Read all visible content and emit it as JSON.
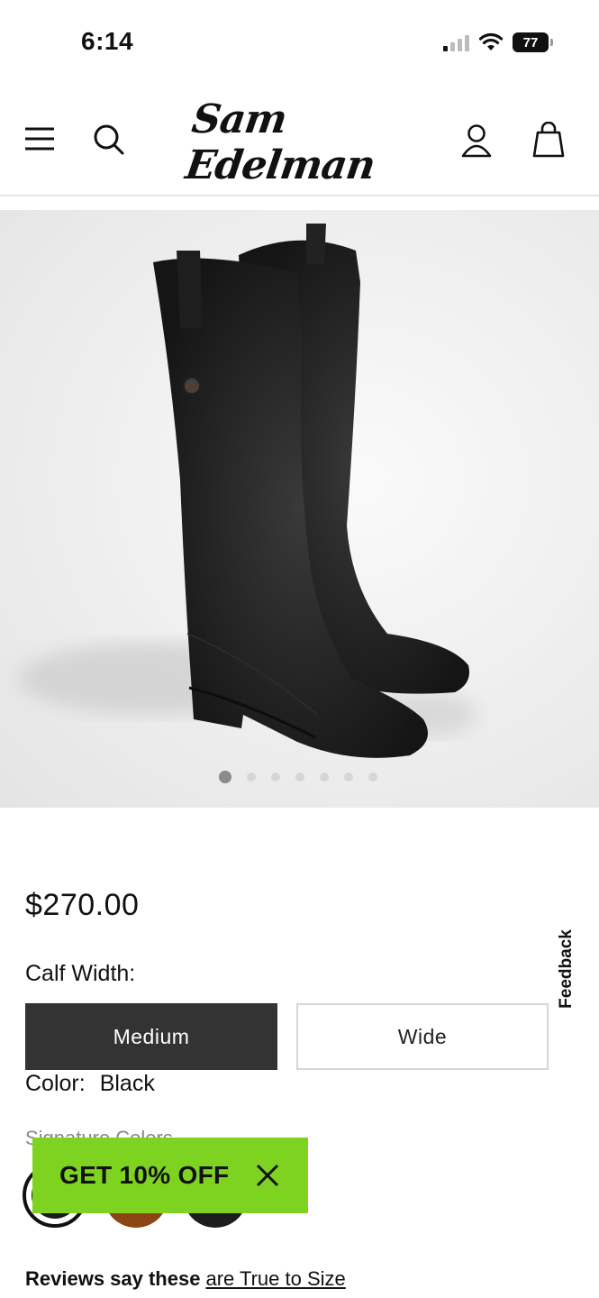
{
  "status_bar": {
    "time": "6:14",
    "battery": "77",
    "signal_icon": "cellular-signal-icon",
    "wifi_icon": "wifi-icon"
  },
  "header": {
    "logo_text": "Sam Edelman",
    "icons": [
      "menu-icon",
      "search-icon",
      "account-icon",
      "shopping-bag-icon"
    ]
  },
  "gallery": {
    "image": "black-knee-high-riding-boots",
    "dot_count": 7,
    "active_index": 0
  },
  "product": {
    "price": "$270.00",
    "calf_width_label": "Calf Width:",
    "calf_options": [
      "Medium",
      "Wide"
    ],
    "selected_calf": "Medium",
    "color_label": "Color:",
    "color_value": "Black",
    "signature_colors_label": "Signature Colors",
    "swatch_colors": [
      "#1a1a1a",
      "#8b4513",
      "#1d1d1d"
    ]
  },
  "promo": {
    "text": "GET 10% OFF",
    "accent": "#7ed321"
  },
  "feedback_tab": "Feedback",
  "reviews": {
    "prefix": "Reviews say these",
    "link": "are True to Size"
  }
}
